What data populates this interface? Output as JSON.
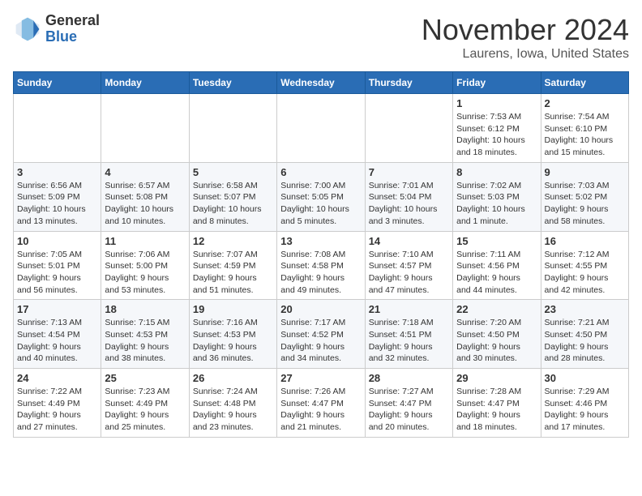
{
  "logo": {
    "general": "General",
    "blue": "Blue"
  },
  "title": "November 2024",
  "location": "Laurens, Iowa, United States",
  "days_of_week": [
    "Sunday",
    "Monday",
    "Tuesday",
    "Wednesday",
    "Thursday",
    "Friday",
    "Saturday"
  ],
  "weeks": [
    [
      {
        "day": "",
        "info": ""
      },
      {
        "day": "",
        "info": ""
      },
      {
        "day": "",
        "info": ""
      },
      {
        "day": "",
        "info": ""
      },
      {
        "day": "",
        "info": ""
      },
      {
        "day": "1",
        "info": "Sunrise: 7:53 AM\nSunset: 6:12 PM\nDaylight: 10 hours\nand 18 minutes."
      },
      {
        "day": "2",
        "info": "Sunrise: 7:54 AM\nSunset: 6:10 PM\nDaylight: 10 hours\nand 15 minutes."
      }
    ],
    [
      {
        "day": "3",
        "info": "Sunrise: 6:56 AM\nSunset: 5:09 PM\nDaylight: 10 hours\nand 13 minutes."
      },
      {
        "day": "4",
        "info": "Sunrise: 6:57 AM\nSunset: 5:08 PM\nDaylight: 10 hours\nand 10 minutes."
      },
      {
        "day": "5",
        "info": "Sunrise: 6:58 AM\nSunset: 5:07 PM\nDaylight: 10 hours\nand 8 minutes."
      },
      {
        "day": "6",
        "info": "Sunrise: 7:00 AM\nSunset: 5:05 PM\nDaylight: 10 hours\nand 5 minutes."
      },
      {
        "day": "7",
        "info": "Sunrise: 7:01 AM\nSunset: 5:04 PM\nDaylight: 10 hours\nand 3 minutes."
      },
      {
        "day": "8",
        "info": "Sunrise: 7:02 AM\nSunset: 5:03 PM\nDaylight: 10 hours\nand 1 minute."
      },
      {
        "day": "9",
        "info": "Sunrise: 7:03 AM\nSunset: 5:02 PM\nDaylight: 9 hours\nand 58 minutes."
      }
    ],
    [
      {
        "day": "10",
        "info": "Sunrise: 7:05 AM\nSunset: 5:01 PM\nDaylight: 9 hours\nand 56 minutes."
      },
      {
        "day": "11",
        "info": "Sunrise: 7:06 AM\nSunset: 5:00 PM\nDaylight: 9 hours\nand 53 minutes."
      },
      {
        "day": "12",
        "info": "Sunrise: 7:07 AM\nSunset: 4:59 PM\nDaylight: 9 hours\nand 51 minutes."
      },
      {
        "day": "13",
        "info": "Sunrise: 7:08 AM\nSunset: 4:58 PM\nDaylight: 9 hours\nand 49 minutes."
      },
      {
        "day": "14",
        "info": "Sunrise: 7:10 AM\nSunset: 4:57 PM\nDaylight: 9 hours\nand 47 minutes."
      },
      {
        "day": "15",
        "info": "Sunrise: 7:11 AM\nSunset: 4:56 PM\nDaylight: 9 hours\nand 44 minutes."
      },
      {
        "day": "16",
        "info": "Sunrise: 7:12 AM\nSunset: 4:55 PM\nDaylight: 9 hours\nand 42 minutes."
      }
    ],
    [
      {
        "day": "17",
        "info": "Sunrise: 7:13 AM\nSunset: 4:54 PM\nDaylight: 9 hours\nand 40 minutes."
      },
      {
        "day": "18",
        "info": "Sunrise: 7:15 AM\nSunset: 4:53 PM\nDaylight: 9 hours\nand 38 minutes."
      },
      {
        "day": "19",
        "info": "Sunrise: 7:16 AM\nSunset: 4:53 PM\nDaylight: 9 hours\nand 36 minutes."
      },
      {
        "day": "20",
        "info": "Sunrise: 7:17 AM\nSunset: 4:52 PM\nDaylight: 9 hours\nand 34 minutes."
      },
      {
        "day": "21",
        "info": "Sunrise: 7:18 AM\nSunset: 4:51 PM\nDaylight: 9 hours\nand 32 minutes."
      },
      {
        "day": "22",
        "info": "Sunrise: 7:20 AM\nSunset: 4:50 PM\nDaylight: 9 hours\nand 30 minutes."
      },
      {
        "day": "23",
        "info": "Sunrise: 7:21 AM\nSunset: 4:50 PM\nDaylight: 9 hours\nand 28 minutes."
      }
    ],
    [
      {
        "day": "24",
        "info": "Sunrise: 7:22 AM\nSunset: 4:49 PM\nDaylight: 9 hours\nand 27 minutes."
      },
      {
        "day": "25",
        "info": "Sunrise: 7:23 AM\nSunset: 4:49 PM\nDaylight: 9 hours\nand 25 minutes."
      },
      {
        "day": "26",
        "info": "Sunrise: 7:24 AM\nSunset: 4:48 PM\nDaylight: 9 hours\nand 23 minutes."
      },
      {
        "day": "27",
        "info": "Sunrise: 7:26 AM\nSunset: 4:47 PM\nDaylight: 9 hours\nand 21 minutes."
      },
      {
        "day": "28",
        "info": "Sunrise: 7:27 AM\nSunset: 4:47 PM\nDaylight: 9 hours\nand 20 minutes."
      },
      {
        "day": "29",
        "info": "Sunrise: 7:28 AM\nSunset: 4:47 PM\nDaylight: 9 hours\nand 18 minutes."
      },
      {
        "day": "30",
        "info": "Sunrise: 7:29 AM\nSunset: 4:46 PM\nDaylight: 9 hours\nand 17 minutes."
      }
    ]
  ]
}
